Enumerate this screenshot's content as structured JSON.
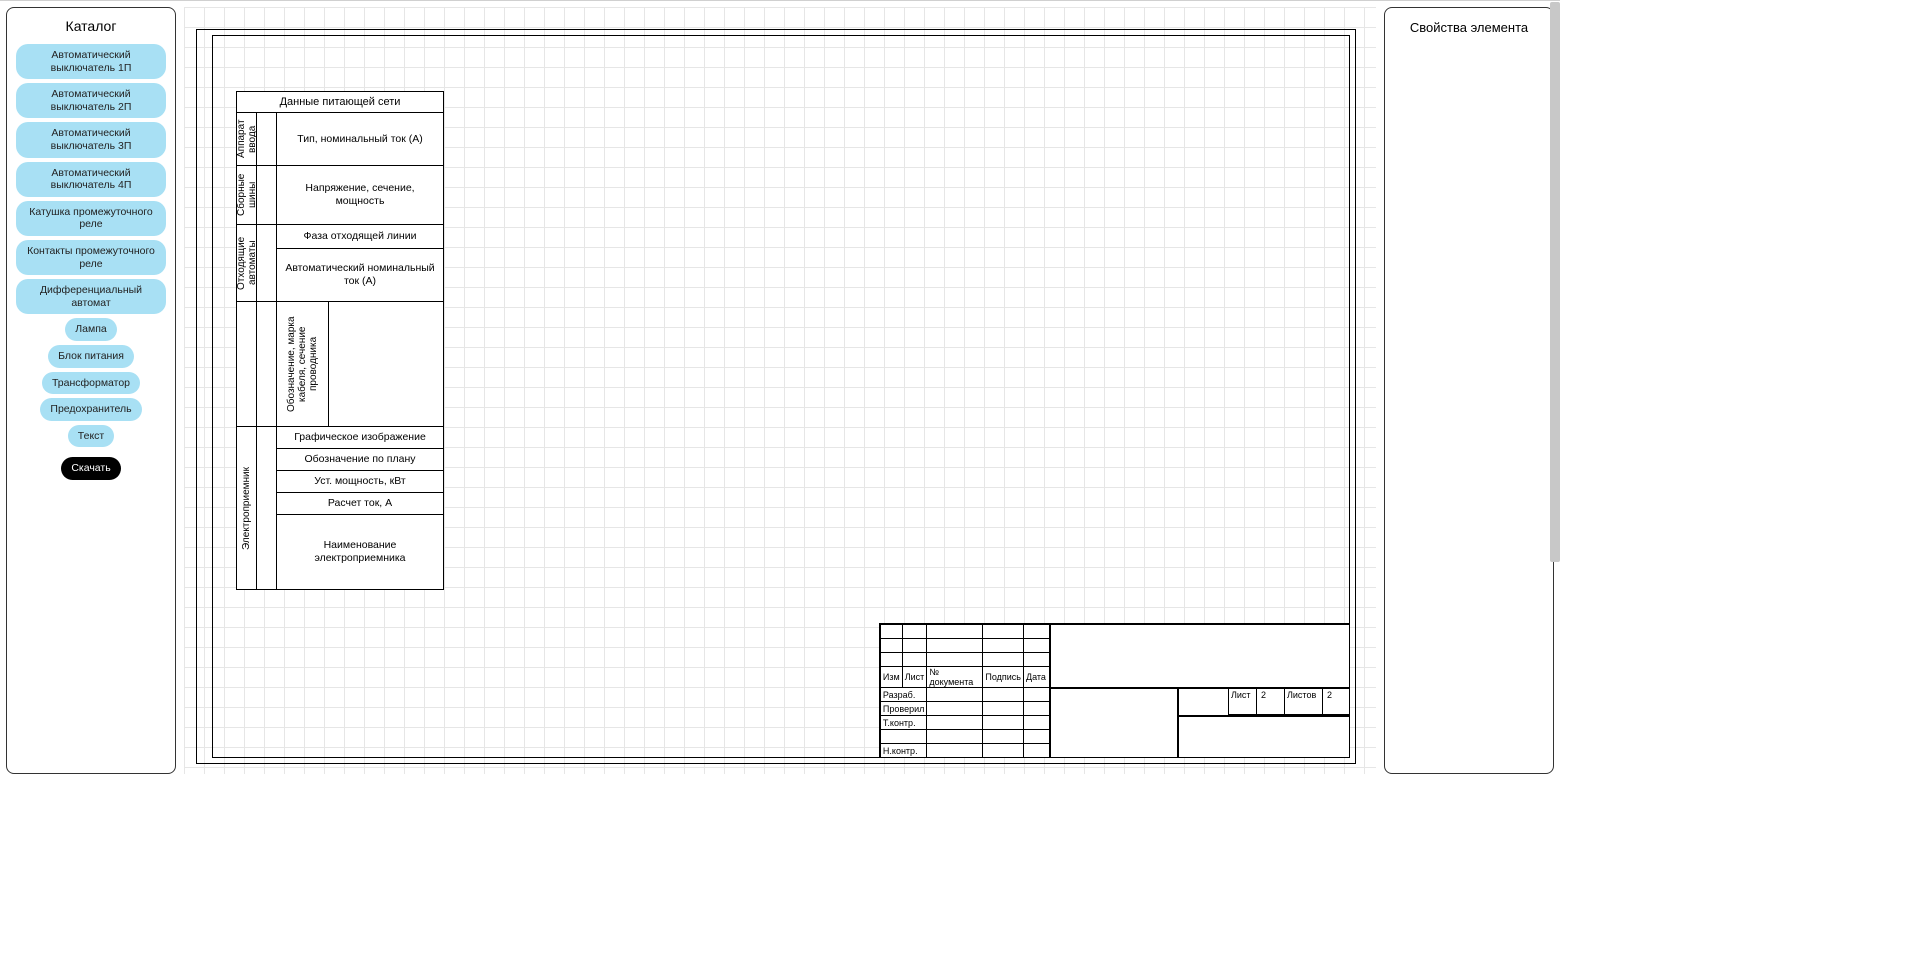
{
  "catalog": {
    "title": "Каталог",
    "items": [
      "Автоматический выключатель 1П",
      "Автоматический выключатель 2П",
      "Автоматический выключатель 3П",
      "Автоматический выключатель 4П",
      "Катушка промежуточного реле",
      "Контакты промежуточного реле",
      "Дифференциальный автомат",
      "Лампа",
      "Блок питания",
      "Трансформатор",
      "Предохранитель",
      "Текст"
    ],
    "download": "Скачать"
  },
  "properties": {
    "title": "Свойства элемента"
  },
  "data_table": {
    "header": "Данные питающей сети",
    "groups": [
      {
        "vlabel": "Аппарат ввода",
        "rows": [
          "Тип, номинальный ток (А)"
        ]
      },
      {
        "vlabel": "Сборные шины",
        "rows": [
          "Напряжение, сечение, мощность"
        ]
      },
      {
        "vlabel": "Отходящие автоматы",
        "rows": [
          "Фаза отходящей линии",
          "Автоматический номинальный ток (А)"
        ]
      },
      {
        "vlabel": "",
        "vertical_content": "Обозначение, марка кабеля, сечение проводника",
        "rows": []
      },
      {
        "vlabel": "Электроприемник",
        "rows": [
          "Графическое изображение",
          "Обозначение по плану",
          "Уст. мощность, кВт",
          "Расчет ток, А",
          "Наименование электроприемника"
        ]
      }
    ]
  },
  "stamp": {
    "col_headers": [
      "Изм",
      "Лист",
      "№ документа",
      "Подпись",
      "Дата"
    ],
    "row_labels": [
      "Разраб.",
      "Проверил",
      "Т.контр.",
      "",
      "Н.контр."
    ],
    "sheet_label": "Лист",
    "sheet_value": "2",
    "sheets_label": "Листов",
    "sheets_value": "2"
  }
}
